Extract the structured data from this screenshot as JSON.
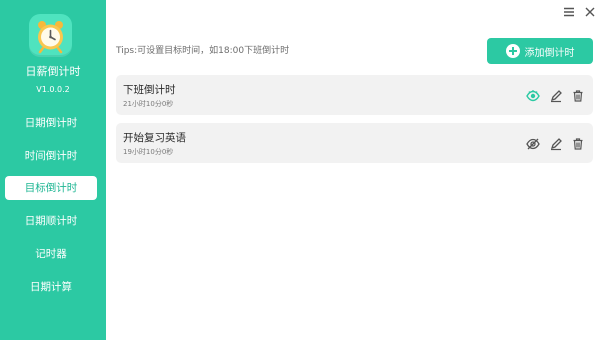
{
  "app": {
    "name": "日薪倒计时",
    "version": "V1.0.0.2"
  },
  "nav": [
    {
      "label": "日期倒计时",
      "active": false
    },
    {
      "label": "时间倒计时",
      "active": false
    },
    {
      "label": "目标倒计时",
      "active": true
    },
    {
      "label": "日期顺计时",
      "active": false
    },
    {
      "label": "记时器",
      "active": false
    },
    {
      "label": "日期计算",
      "active": false
    }
  ],
  "tips": "Tips:可设置目标时间，如18:00下班倒计时",
  "add_button": "添加倒计时",
  "countdowns": [
    {
      "title": "下班倒计时",
      "remaining": "21小时10分0秒",
      "visible": true
    },
    {
      "title": "开始复习英语",
      "remaining": "19小时10分0秒",
      "visible": false
    }
  ],
  "colors": {
    "accent": "#2cc9a3",
    "accent_light": "#4fe3bf"
  },
  "icons": {
    "menu": "menu-icon",
    "close": "close-icon",
    "eye": "eye-icon",
    "eye_off": "eye-off-icon",
    "edit": "pencil-icon",
    "delete": "trash-icon"
  }
}
